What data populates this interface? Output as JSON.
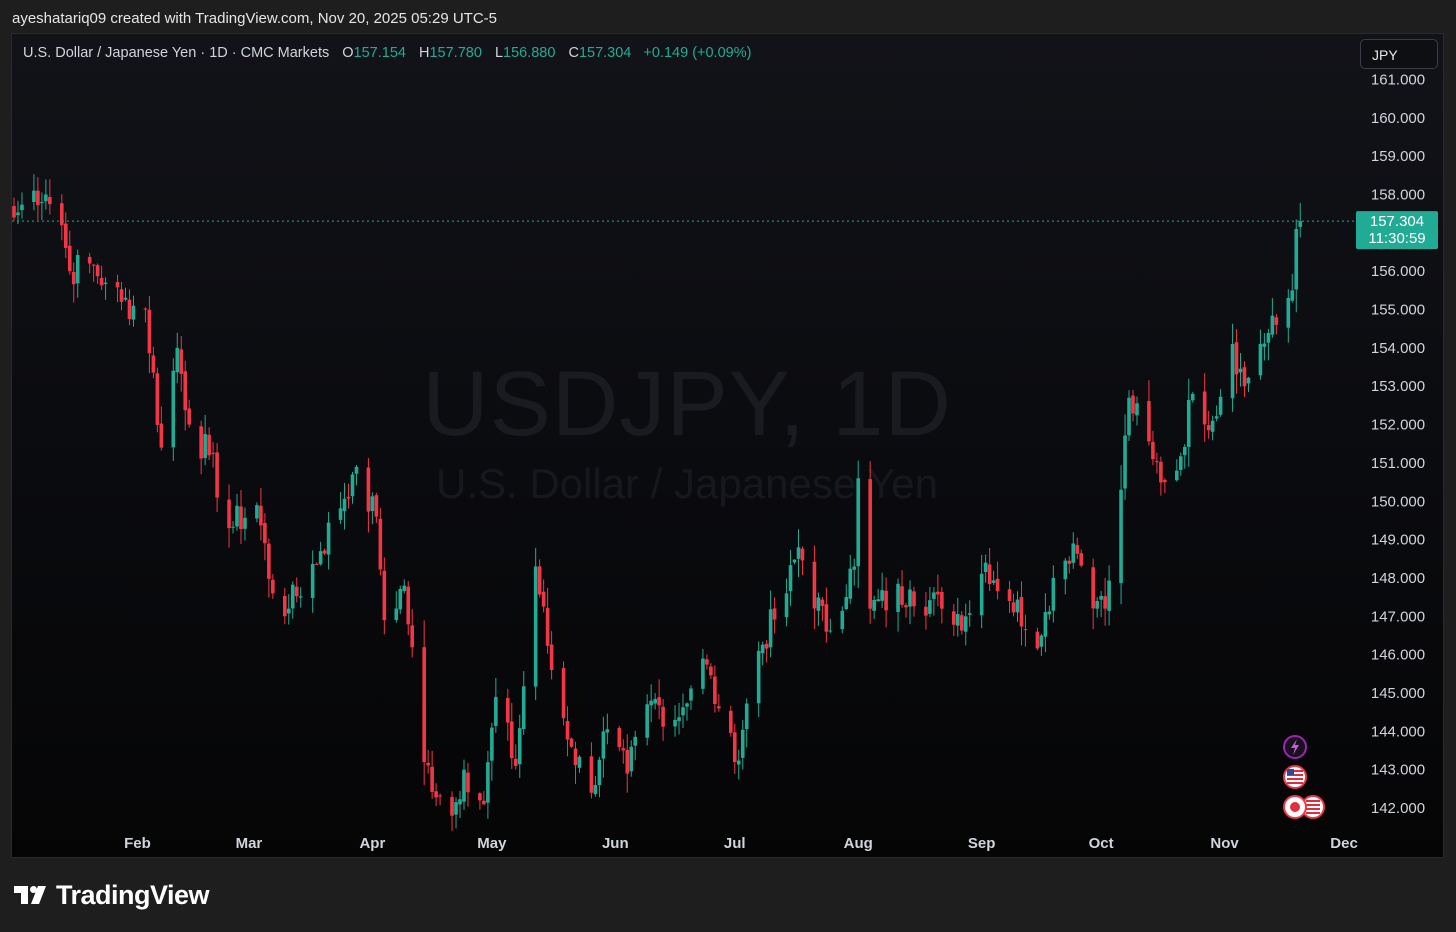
{
  "header": {
    "attribution": "ayeshatariq09 created with TradingView.com, Nov 20, 2025 05:29 UTC-5"
  },
  "legend": {
    "symbol_line": "U.S. Dollar / Japanese Yen · 1D · CMC Markets",
    "o_label": "O",
    "o_value": "157.154",
    "h_label": "H",
    "h_value": "157.780",
    "l_label": "L",
    "l_value": "156.880",
    "c_label": "C",
    "c_value": "157.304",
    "change": "+0.149 (+0.09%)"
  },
  "currency_button": "JPY",
  "watermark": {
    "title": "USDJPY, 1D",
    "subtitle": "U.S. Dollar / Japanese Yen"
  },
  "last_price": {
    "price": "157.304",
    "countdown": "11:30:59"
  },
  "footer": {
    "brand": "TradingView"
  },
  "colors": {
    "up": "#22ab94",
    "down": "#f23645",
    "axis_text": "#d1d4dc",
    "price_line": "#22ab94"
  },
  "icons": [
    "lightning-event-icon",
    "us-flag-event-icon",
    "japan-us-flags-event-icon"
  ],
  "chart_data": {
    "type": "candlestick",
    "y_ticks": [
      "142.000",
      "143.000",
      "144.000",
      "145.000",
      "146.000",
      "147.000",
      "148.000",
      "149.000",
      "150.000",
      "151.000",
      "152.000",
      "153.000",
      "154.000",
      "155.000",
      "156.000",
      "157.000",
      "158.000",
      "159.000",
      "160.000",
      "161.000"
    ],
    "ylim": [
      141.5,
      161.1
    ],
    "x_ticks": [
      "Feb",
      "Mar",
      "Apr",
      "May",
      "Jun",
      "Jul",
      "Aug",
      "Sep",
      "Oct",
      "Nov",
      "Dec"
    ],
    "x_range": [
      "2025-01-01",
      "2025-12-04"
    ],
    "last_close": 157.304,
    "anchors": [
      {
        "date": "2025-01-01",
        "close": 157.4
      },
      {
        "date": "2025-01-06",
        "close": 158.1
      },
      {
        "date": "2025-01-09",
        "close": 158.0
      },
      {
        "date": "2025-01-13",
        "close": 157.2
      },
      {
        "date": "2025-01-15",
        "close": 156.0
      },
      {
        "date": "2025-01-20",
        "close": 156.2
      },
      {
        "date": "2025-01-24",
        "close": 155.7
      },
      {
        "date": "2025-01-28",
        "close": 155.2
      },
      {
        "date": "2025-02-03",
        "close": 155.0
      },
      {
        "date": "2025-02-07",
        "close": 151.4
      },
      {
        "date": "2025-02-11",
        "close": 154.0
      },
      {
        "date": "2025-02-14",
        "close": 152.0
      },
      {
        "date": "2025-02-19",
        "close": 151.2
      },
      {
        "date": "2025-02-24",
        "close": 149.3
      },
      {
        "date": "2025-03-03",
        "close": 149.9
      },
      {
        "date": "2025-03-07",
        "close": 147.6
      },
      {
        "date": "2025-03-11",
        "close": 147.2
      },
      {
        "date": "2025-03-19",
        "close": 148.7
      },
      {
        "date": "2025-03-27",
        "close": 150.7
      },
      {
        "date": "2025-04-02",
        "close": 149.6
      },
      {
        "date": "2025-04-04",
        "close": 146.9
      },
      {
        "date": "2025-04-09",
        "close": 147.8
      },
      {
        "date": "2025-04-14",
        "close": 143.2
      },
      {
        "date": "2025-04-18",
        "close": 142.3
      },
      {
        "date": "2025-04-21",
        "close": 141.8
      },
      {
        "date": "2025-04-24",
        "close": 143.0
      },
      {
        "date": "2025-04-29",
        "close": 142.1
      },
      {
        "date": "2025-05-02",
        "close": 144.9
      },
      {
        "date": "2025-05-07",
        "close": 143.1
      },
      {
        "date": "2025-05-12",
        "close": 148.3
      },
      {
        "date": "2025-05-16",
        "close": 145.6
      },
      {
        "date": "2025-05-21",
        "close": 143.6
      },
      {
        "date": "2025-05-26",
        "close": 142.4
      },
      {
        "date": "2025-05-29",
        "close": 144.0
      },
      {
        "date": "2025-06-04",
        "close": 142.9
      },
      {
        "date": "2025-06-10",
        "close": 144.8
      },
      {
        "date": "2025-06-16",
        "close": 144.3
      },
      {
        "date": "2025-06-23",
        "close": 145.9
      },
      {
        "date": "2025-06-27",
        "close": 144.6
      },
      {
        "date": "2025-07-01",
        "close": 143.2
      },
      {
        "date": "2025-07-07",
        "close": 146.1
      },
      {
        "date": "2025-07-14",
        "close": 147.6
      },
      {
        "date": "2025-07-17",
        "close": 148.8
      },
      {
        "date": "2025-07-24",
        "close": 146.6
      },
      {
        "date": "2025-07-31",
        "close": 148.3
      },
      {
        "date": "2025-08-01",
        "close": 150.6
      },
      {
        "date": "2025-08-04",
        "close": 147.2
      },
      {
        "date": "2025-08-14",
        "close": 147.7
      },
      {
        "date": "2025-08-22",
        "close": 147.2
      },
      {
        "date": "2025-08-28",
        "close": 147.0
      },
      {
        "date": "2025-09-02",
        "close": 148.4
      },
      {
        "date": "2025-09-08",
        "close": 147.4
      },
      {
        "date": "2025-09-16",
        "close": 146.5
      },
      {
        "date": "2025-09-19",
        "close": 148.0
      },
      {
        "date": "2025-09-24",
        "close": 148.9
      },
      {
        "date": "2025-09-30",
        "close": 147.4
      },
      {
        "date": "2025-10-02",
        "close": 147.2
      },
      {
        "date": "2025-10-06",
        "close": 150.3
      },
      {
        "date": "2025-10-08",
        "close": 152.7
      },
      {
        "date": "2025-10-14",
        "close": 151.1
      },
      {
        "date": "2025-10-17",
        "close": 150.5
      },
      {
        "date": "2025-10-20",
        "close": 150.8
      },
      {
        "date": "2025-10-24",
        "close": 152.8
      },
      {
        "date": "2025-10-29",
        "close": 152.1
      },
      {
        "date": "2025-11-03",
        "close": 154.1
      },
      {
        "date": "2025-11-06",
        "close": 153.0
      },
      {
        "date": "2025-11-10",
        "close": 154.1
      },
      {
        "date": "2025-11-14",
        "close": 154.6
      },
      {
        "date": "2025-11-18",
        "close": 155.5
      },
      {
        "date": "2025-11-19",
        "close": 157.1
      },
      {
        "date": "2025-11-20",
        "close": 157.304
      }
    ]
  }
}
